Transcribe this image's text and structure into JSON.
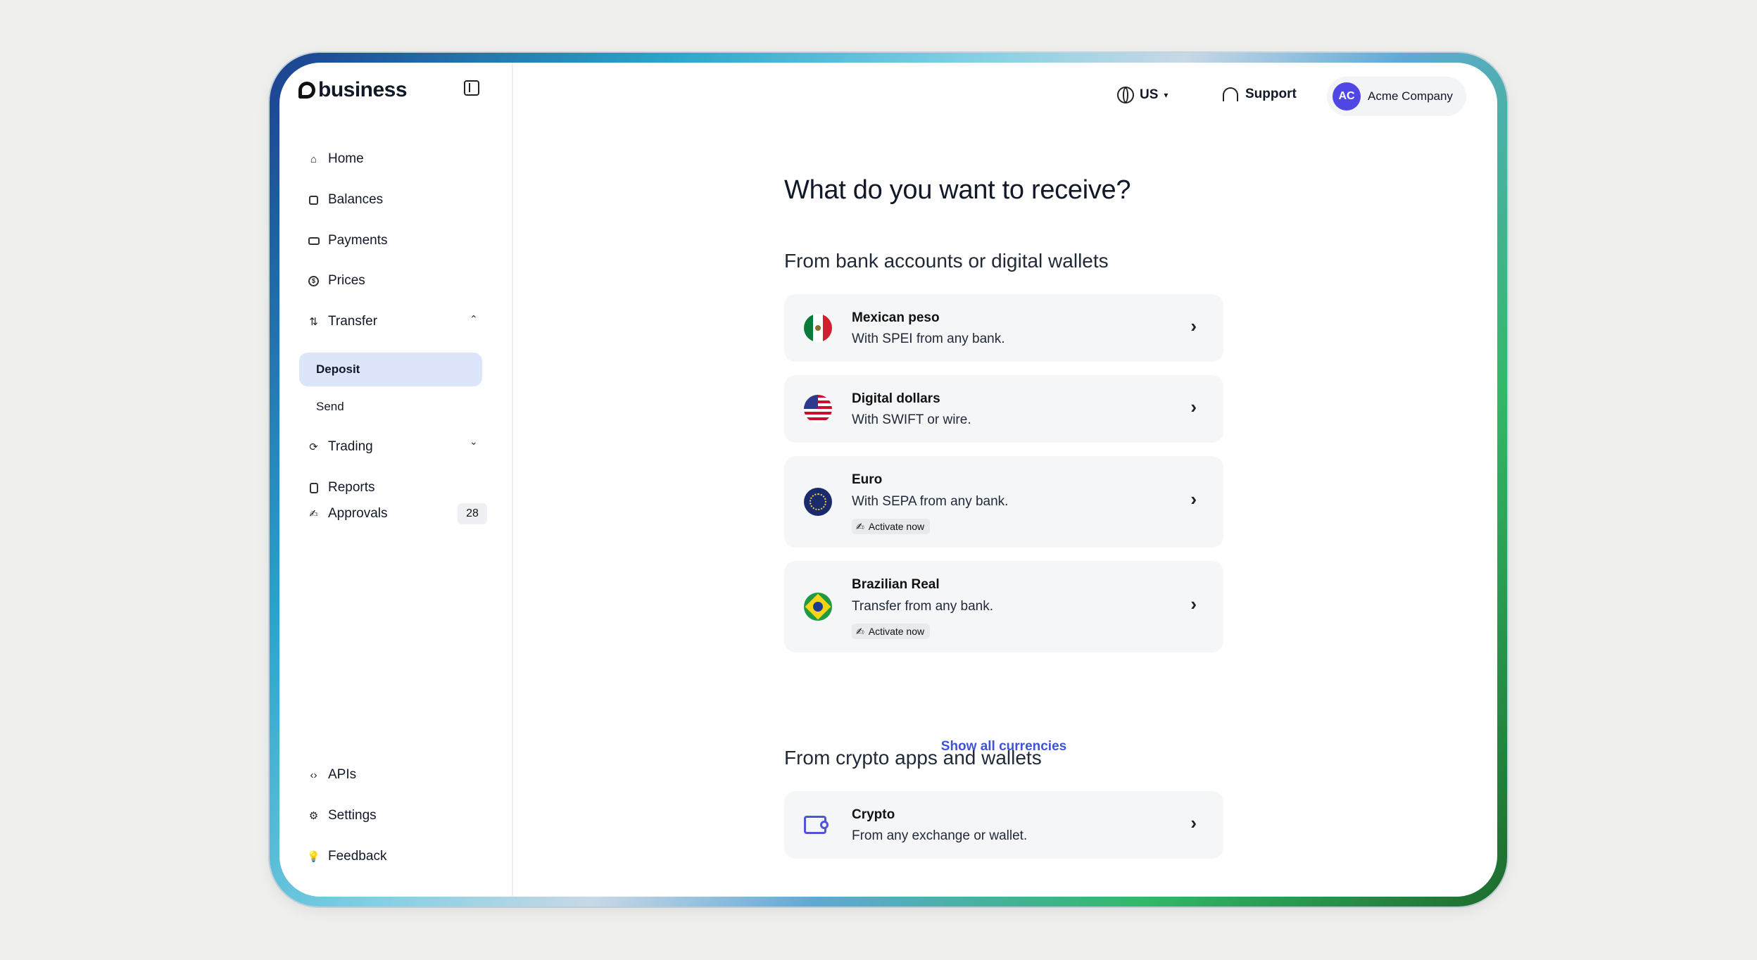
{
  "brand": {
    "name": "business"
  },
  "sidebar": {
    "items": [
      {
        "label": "Home",
        "icon": "home-icon"
      },
      {
        "label": "Balances",
        "icon": "wallet-icon"
      },
      {
        "label": "Payments",
        "icon": "cash-icon"
      },
      {
        "label": "Prices",
        "icon": "dollar-icon"
      },
      {
        "label": "Transfer",
        "icon": "transfer-icon"
      },
      {
        "label": "Trading",
        "icon": "trading-icon"
      },
      {
        "label": "Reports",
        "icon": "document-icon"
      },
      {
        "label": "Approvals",
        "icon": "approval-icon",
        "badge": "28"
      }
    ],
    "transfer_sub": {
      "deposit": "Deposit",
      "send": "Send"
    },
    "bottom": [
      {
        "label": "APIs",
        "icon": "code-icon"
      },
      {
        "label": "Settings",
        "icon": "gear-icon"
      },
      {
        "label": "Feedback",
        "icon": "lightbulb-icon"
      }
    ]
  },
  "header": {
    "country": "US",
    "support": "Support",
    "account": {
      "initials": "AC",
      "name": "Acme Company"
    }
  },
  "main": {
    "title": "What do you want to receive?",
    "bank_section": "From bank accounts or digital wallets",
    "cards": [
      {
        "title": "Mexican peso",
        "subtitle": "With SPEI from any bank."
      },
      {
        "title": "Digital dollars",
        "subtitle": "With SWIFT or wire."
      },
      {
        "title": "Euro",
        "subtitle": "With SEPA from any bank.",
        "tag": "Activate now"
      },
      {
        "title": "Brazilian Real",
        "subtitle": "Transfer from any bank.",
        "tag": "Activate now"
      }
    ],
    "show_all": "Show all currencies",
    "crypto_section": "From crypto apps and wallets",
    "crypto_card": {
      "title": "Crypto",
      "subtitle": "From any exchange or wallet."
    }
  },
  "colors": {
    "accent": "#4053d6",
    "active_nav_bg": "#dde5fb",
    "avatar": "#4f46e5",
    "card_bg": "#f5f6f8"
  }
}
